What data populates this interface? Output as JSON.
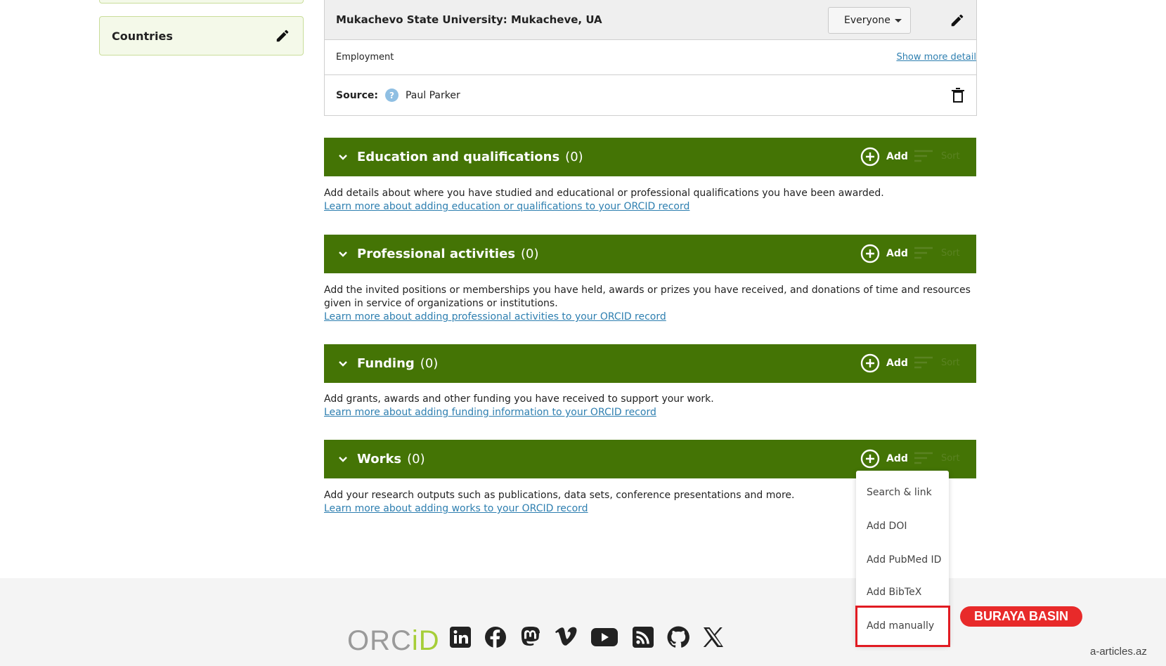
{
  "sidebar": {
    "countries_label": "Countries"
  },
  "affiliation": {
    "title": "Mukachevo State University: Mukacheve, UA",
    "visibility": "Everyone",
    "type": "Employment",
    "show_more": "Show more detail",
    "source_label": "Source:",
    "source_name": "Paul Parker",
    "source_help_glyph": "?"
  },
  "sections": {
    "education": {
      "title": "Education and qualifications",
      "count": "(0)",
      "add": "Add",
      "sort": "Sort",
      "desc": "Add details about where you have studied and educational or professional qualifications you have been awarded.",
      "link": "Learn more about adding education or qualifications to your ORCID record"
    },
    "professional": {
      "title": "Professional activities",
      "count": "(0)",
      "add": "Add",
      "sort": "Sort",
      "desc": "Add the invited positions or memberships you have held, awards or prizes you have received, and donations of time and resources given in service of organizations or institutions.",
      "link": "Learn more about adding professional activities to your ORCID record"
    },
    "funding": {
      "title": "Funding",
      "count": "(0)",
      "add": "Add",
      "sort": "Sort",
      "desc": "Add grants, awards and other funding you have received to support your work.",
      "link": "Learn more about adding funding information to your ORCID record"
    },
    "works": {
      "title": "Works",
      "count": "(0)",
      "add": "Add",
      "sort": "Sort",
      "desc": "Add your research outputs such as publications, data sets, conference presentations and more.",
      "link": "Learn more about adding works to your ORCID record"
    }
  },
  "works_add_menu": [
    "Search & link",
    "Add DOI",
    "Add PubMed ID",
    "Add BibTeX",
    "Add manually"
  ],
  "callout": "BURAYA BASIN",
  "footer": {
    "logo_orc": "ORC",
    "logo_id": "iD",
    "social_icons": [
      "linkedin-icon",
      "facebook-icon",
      "mastodon-icon",
      "vimeo-icon",
      "youtube-icon",
      "rss-icon",
      "github-icon",
      "x-icon"
    ]
  },
  "watermark": "a-articles.az",
  "colors": {
    "section_green": "#447405",
    "link_blue": "#2e7fb0",
    "highlight_red": "#e11b22",
    "logo_green": "#a6ce39"
  }
}
